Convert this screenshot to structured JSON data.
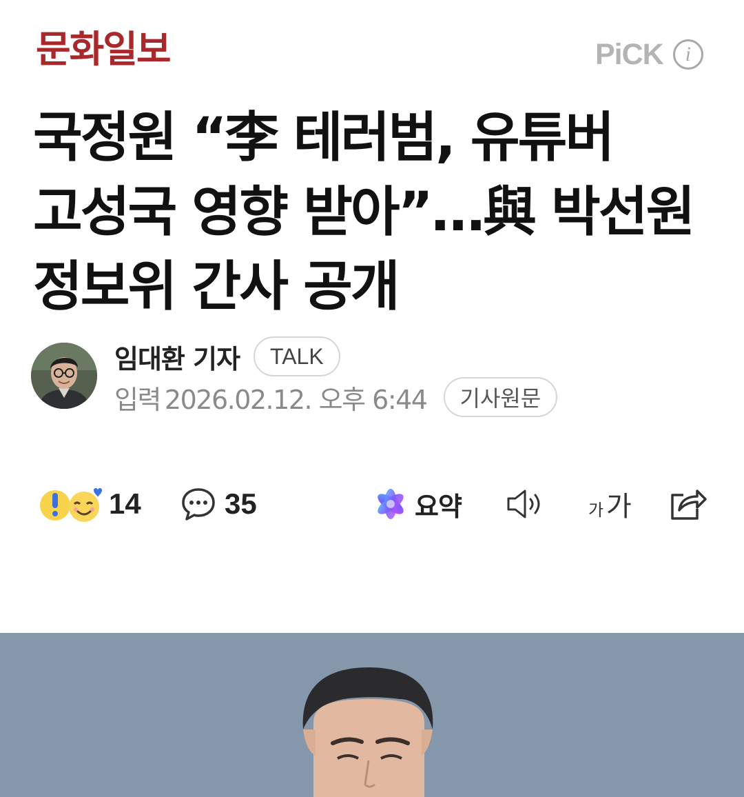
{
  "header": {
    "press_name": "문화일보",
    "pick_label": "PiCK",
    "info_icon": "info-icon",
    "press_color": "#a8282b"
  },
  "article": {
    "headline": "국정원 “李 테러범, 유튜버 고성국 영향 받아”…與 박선원 정보위 간사 공개",
    "author": "임대환 기자",
    "talk_label": "TALK",
    "date_label": "입력",
    "date": "2026.02.12. 오후 6:44",
    "original_label": "기사원문"
  },
  "actions": {
    "reaction_count": "14",
    "comment_count": "35",
    "summary_label": "요약",
    "icons": [
      "reaction-emoji-icon",
      "comment-bubble-icon",
      "ai-summary-icon",
      "speaker-icon",
      "font-size-icon",
      "share-icon"
    ]
  }
}
